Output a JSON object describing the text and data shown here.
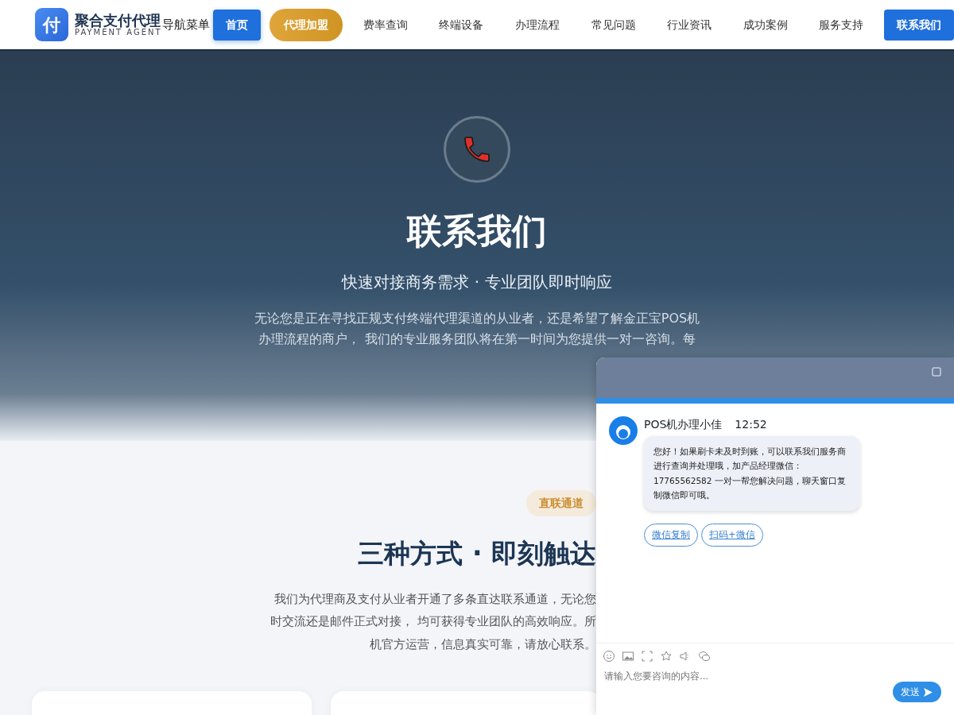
{
  "brand": {
    "logo": "付",
    "name": "聚合支付代理",
    "tagline": "PAYMENT AGENT"
  },
  "nav": {
    "label": "导航菜单",
    "items": [
      {
        "label": "首页",
        "kind": "pill",
        "selected": true
      },
      {
        "label": "代理加盟",
        "kind": "gold",
        "selected": false
      },
      {
        "label": "费率查询",
        "kind": "link",
        "selected": false
      },
      {
        "label": "终端设备",
        "kind": "link",
        "selected": false
      },
      {
        "label": "办理流程",
        "kind": "link",
        "selected": false
      },
      {
        "label": "常见问题",
        "kind": "link",
        "selected": false
      },
      {
        "label": "行业资讯",
        "kind": "link",
        "selected": false
      },
      {
        "label": "成功案例",
        "kind": "link",
        "selected": false
      },
      {
        "label": "服务支持",
        "kind": "link",
        "selected": false
      },
      {
        "label": "联系我们",
        "kind": "cta",
        "selected": false
      }
    ]
  },
  "hero": {
    "title": "联系我们",
    "subtitle": "快速对接商务需求 · 专业团队即时响应",
    "paragraph": [
      "无论您是正在寻找正规支付终端代理渠道的从业者，还是希望了解金正宝POS机",
      "办理流程的商户， 我们的专业服务团队将在第一时间为您提供一对一咨询。每"
    ]
  },
  "section": {
    "badge": "直联通道",
    "title": "三种方式 · 即刻触达",
    "paragraph": [
      "我们为代理商及支付从业者开通了多条直达联系通道，无论您",
      "时交流还是邮件正式对接， 均可获得专业团队的高效响应。所",
      "机官方运营，信息真实可靠，请放心联系。"
    ]
  },
  "chat": {
    "messages": [
      {
        "author": "POS机办理小佳",
        "time": "12:52",
        "text": "您好！如果刷卡未及时到账，可以联系我们服务商进行查询并处理哦，加产品经理微信：17765562582 一对一帮您解决问题，聊天窗口复制微信即可哦。",
        "actions": [
          "微信复制",
          "扫码+微信"
        ]
      }
    ],
    "input": {
      "placeholder": "请输入您要咨询的内容..."
    },
    "send": "发送"
  }
}
